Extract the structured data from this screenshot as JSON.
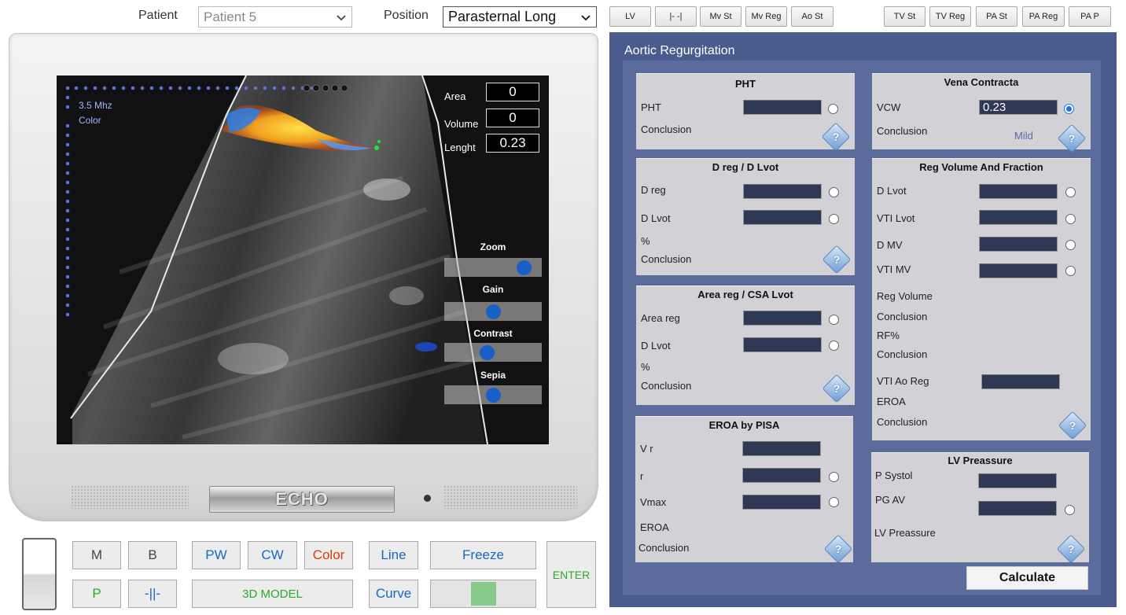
{
  "top": {
    "patient_label": "Patient",
    "patient_value": "Patient 5",
    "position_label": "Position",
    "position_value": "Parasternal Long",
    "buttons_left": [
      "LV",
      "|- -|",
      "Mv St",
      "Mv Reg",
      "Ao St"
    ],
    "buttons_right": [
      "TV St",
      "TV Reg",
      "PA St",
      "PA Reg",
      "PA P"
    ]
  },
  "screen": {
    "freq": "3.5 Mhz",
    "mode": "Color",
    "area_label": "Area",
    "area_value": "0",
    "volume_label": "Volume",
    "volume_value": "0",
    "length_label": "Lenght",
    "length_value": "0.23",
    "sliders": [
      {
        "label": "Zoom",
        "level": 0.9
      },
      {
        "label": "Gain",
        "level": 0.5
      },
      {
        "label": "Contrast",
        "level": 0.42
      },
      {
        "label": "Sepia",
        "level": 0.5
      }
    ]
  },
  "monitor": {
    "brand": "ECHO"
  },
  "controls": {
    "m": "M",
    "b": "B",
    "pw": "PW",
    "cw": "CW",
    "color": "Color",
    "line": "Line",
    "freeze": "Freeze",
    "enter": "ENTER",
    "p": "P",
    "split": "-||-",
    "model3d": "3D MODEL",
    "curve": "Curve"
  },
  "panel": {
    "title": "Aortic Regurgitation",
    "pht": {
      "title": "PHT",
      "pht_label": "PHT",
      "pht_value": "",
      "conclusion_label": "Conclusion"
    },
    "vena": {
      "title": "Vena Contracta",
      "vcw_label": "VCW",
      "vcw_value": "0.23",
      "conclusion_label": "Conclusion",
      "conclusion_value": "Mild"
    },
    "dreg": {
      "title": "D reg / D Lvot",
      "dreg_label": "D reg",
      "dlvot_label": "D Lvot",
      "pct_label": "%",
      "conclusion_label": "Conclusion"
    },
    "area": {
      "title": "Area reg / CSA Lvot",
      "areareg_label": "Area reg",
      "dlvot_label": "D Lvot",
      "pct_label": "%",
      "conclusion_label": "Conclusion"
    },
    "pisa": {
      "title": "EROA by PISA",
      "vr_label": "V r",
      "r_label": "r",
      "vmax_label": "Vmax",
      "eroa_label": "EROA",
      "conclusion_label": "Conclusion"
    },
    "regvol": {
      "title": "Reg Volume And Fraction",
      "dlvot_label": "D Lvot",
      "vtilvot_label": "VTI Lvot",
      "dmv_label": "D MV",
      "vtimv_label": "VTI MV",
      "regvolume_label": "Reg Volume",
      "conclusion1_label": "Conclusion",
      "rf_label": "RF%",
      "conclusion2_label": "Conclusion",
      "vtiaoreg_label": "VTI Ao Reg",
      "eroa_label": "EROA",
      "conclusion3_label": "Conclusion"
    },
    "lvp": {
      "title": "LV Preassure",
      "psystol_label": "P Systol",
      "pgav_label": "PG AV",
      "lvp_label": "LV Preassure"
    },
    "help_glyph": "?",
    "calculate": "Calculate"
  }
}
